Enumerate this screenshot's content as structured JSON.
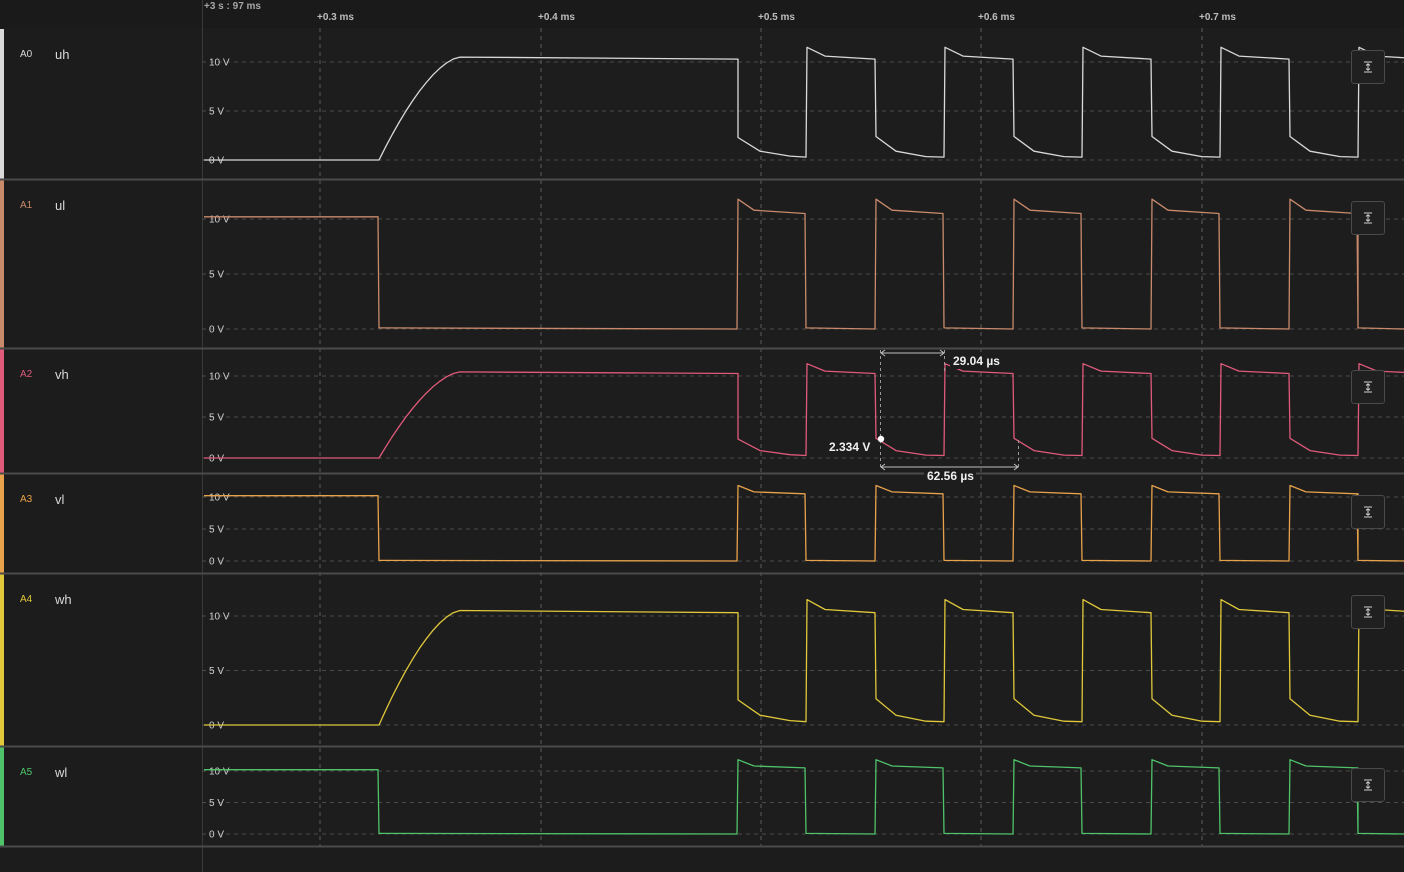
{
  "timebar": {
    "origin": "+3 s : 97 ms",
    "ticks": [
      "+0.3 ms",
      "+0.4 ms",
      "+0.5 ms",
      "+0.6 ms",
      "+0.7 ms"
    ]
  },
  "channels": [
    {
      "id": "A0",
      "name": "uh",
      "color": "#d9d9d9",
      "levels": [
        "10 V",
        "5 V",
        "0 V"
      ]
    },
    {
      "id": "A1",
      "name": "ul",
      "color": "#c98a6b",
      "levels": [
        "10 V",
        "5 V",
        "0 V"
      ]
    },
    {
      "id": "A2",
      "name": "vh",
      "color": "#e05a7a",
      "levels": [
        "10 V",
        "5 V",
        "0 V"
      ]
    },
    {
      "id": "A3",
      "name": "vl",
      "color": "#e8a24a",
      "levels": [
        "10 V",
        "5 V",
        "0 V"
      ]
    },
    {
      "id": "A4",
      "name": "wh",
      "color": "#e0c83a",
      "levels": [
        "10 V",
        "5 V",
        "0 V"
      ]
    },
    {
      "id": "A5",
      "name": "wl",
      "color": "#4fc36a",
      "levels": [
        "10 V",
        "5 V",
        "0 V"
      ]
    }
  ],
  "measurements": {
    "pulse_width": "29.04 µs",
    "period": "62.56 µs",
    "voltage": "2.334 V"
  },
  "controls": {
    "autoscale_icon": "vertical-fit-icon"
  }
}
